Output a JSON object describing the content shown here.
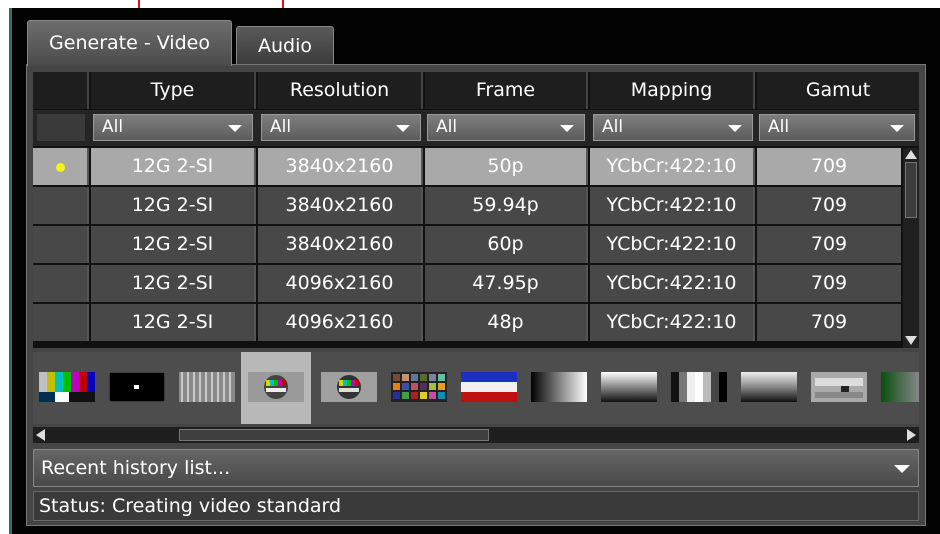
{
  "tabs": [
    {
      "label": "Generate - Video",
      "active": true
    },
    {
      "label": "Audio",
      "active": false
    }
  ],
  "table": {
    "columns": [
      "Type",
      "Resolution",
      "Frame",
      "Mapping",
      "Gamut"
    ],
    "filters": [
      "All",
      "All",
      "All",
      "All",
      "All"
    ],
    "rows": [
      {
        "selected": true,
        "cells": [
          "12G 2-SI",
          "3840x2160",
          "50p",
          "YCbCr:422:10",
          "709"
        ]
      },
      {
        "selected": false,
        "cells": [
          "12G 2-SI",
          "3840x2160",
          "59.94p",
          "YCbCr:422:10",
          "709"
        ]
      },
      {
        "selected": false,
        "cells": [
          "12G 2-SI",
          "3840x2160",
          "60p",
          "YCbCr:422:10",
          "709"
        ]
      },
      {
        "selected": false,
        "cells": [
          "12G 2-SI",
          "4096x2160",
          "47.95p",
          "YCbCr:422:10",
          "709"
        ]
      },
      {
        "selected": false,
        "cells": [
          "12G 2-SI",
          "4096x2160",
          "48p",
          "YCbCr:422:10",
          "709"
        ]
      }
    ]
  },
  "pattern_thumbnails": [
    "smpte-bars-icon",
    "black-dot-icon",
    "vertical-lines-icon",
    "test-card-icon",
    "test-card-alt-icon",
    "color-checker-icon",
    "rgb-bars-icon",
    "horizontal-gradient-icon",
    "vertical-ramp-icon",
    "gray-steps-icon",
    "vertical-gradient-icon",
    "pluge-icon",
    "green-ramp-icon"
  ],
  "history": {
    "placeholder": "Recent history list..."
  },
  "status": {
    "text": "Status: Creating video standard"
  },
  "colors": {
    "selected_row": "#a9a9a9",
    "indicator_dot": "#f3f315",
    "annotation_arrow": "#e01010"
  }
}
